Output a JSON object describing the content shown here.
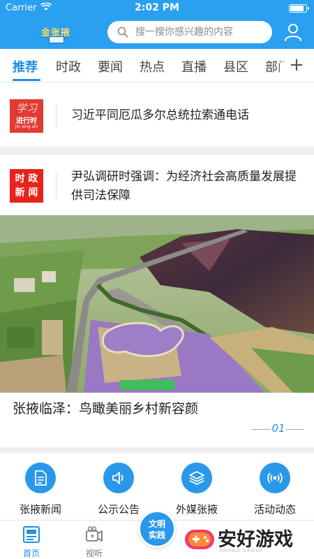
{
  "status_bar": {
    "carrier": "Carrier",
    "time": "2:02 PM",
    "battery_level": 0.95
  },
  "header": {
    "logo_text": "金张掖",
    "search_placeholder": "搜一搜你感兴趣的内容"
  },
  "tabs": [
    {
      "label": "推荐",
      "active": true
    },
    {
      "label": "时政"
    },
    {
      "label": "要闻"
    },
    {
      "label": "热点"
    },
    {
      "label": "直播"
    },
    {
      "label": "县区"
    },
    {
      "label": "部门"
    }
  ],
  "tab_add_label": "+",
  "news": [
    {
      "source_logo": {
        "line1": "学习",
        "line2": "进行时",
        "line3": "jin xing shi"
      },
      "title": "习近平同厄瓜多尔总统拉索通电话"
    },
    {
      "source_logo": {
        "line1": "时 政",
        "line2": "新 闻"
      },
      "title": "尹弘调研时强调：为经济社会高质量发展提供司法保障"
    }
  ],
  "banner": {
    "caption": "张掖临泽：鸟瞰美丽乡村新容颜",
    "page": "01"
  },
  "quick_links": [
    {
      "label": "张掖新闻",
      "icon": "document-icon"
    },
    {
      "label": "公示公告",
      "icon": "speaker-icon"
    },
    {
      "label": "外媒张掖",
      "icon": "layers-icon"
    },
    {
      "label": "活动动态",
      "icon": "broadcast-icon"
    }
  ],
  "bottom_nav": {
    "home": "首页",
    "video": "视听",
    "center_badge": "文明\n实践"
  },
  "watermark": {
    "text": "安好游戏",
    "sub": "ANHAO GROUP"
  },
  "colors": {
    "brand_blue": "#2aa0f0",
    "accent": "#1f8fe6",
    "red": "#e13b32"
  }
}
